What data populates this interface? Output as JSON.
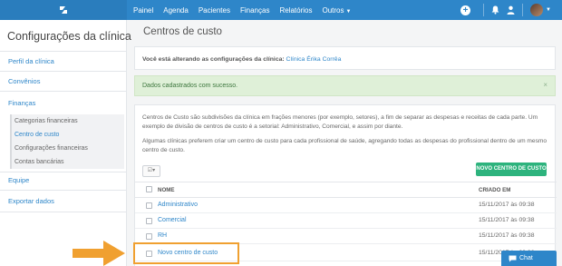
{
  "topbar": {
    "nav": [
      {
        "label": "Painel",
        "has_caret": false
      },
      {
        "label": "Agenda",
        "has_caret": false
      },
      {
        "label": "Pacientes",
        "has_caret": false
      },
      {
        "label": "Finanças",
        "has_caret": false
      },
      {
        "label": "Relatórios",
        "has_caret": false
      },
      {
        "label": "Outros",
        "has_caret": true
      }
    ],
    "icons": [
      "logo-icon",
      "add-circle-icon",
      "bell-icon",
      "user-icon",
      "avatar",
      "chevron-down-icon"
    ]
  },
  "sidebar": {
    "title": "Configurações da clínica",
    "links": {
      "perfil": "Perfil da clínica",
      "convenios": "Convênios",
      "financas": "Finanças",
      "equipe": "Equipe",
      "exportar": "Exportar dados"
    },
    "sub_items": [
      {
        "label": "Categorias financeiras",
        "active": false
      },
      {
        "label": "Centro de custo",
        "active": true
      },
      {
        "label": "Configurações financeiras",
        "active": false
      },
      {
        "label": "Contas bancárias",
        "active": false
      }
    ]
  },
  "main": {
    "title": "Centros de custo",
    "clinic_notice_prefix": "Você está alterando as configurações da clínica:",
    "clinic_name": "Clínica Érika Corrêa",
    "alert": {
      "message": "Dados cadastrados com sucesso.",
      "close": "×"
    },
    "description_1": "Centros de Custo são subdivisões da clínica em frações menores (por exemplo, setores), a fim de separar as despesas e receitas de cada parte. Um exemplo de divisão de centros de custo é a setorial: Administrativo, Comercial, e assim por diante.",
    "description_2": "Algumas clínicas preferem criar um centro de custo para cada profissional de saúde, agregando todas as despesas do profissional dentro de um mesmo centro de custo.",
    "filter_button": "☑▾",
    "new_button": "NOVO CENTRO DE CUSTO",
    "table": {
      "headers": {
        "name": "NOME",
        "created": "CRIADO EM"
      },
      "rows": [
        {
          "name": "Administrativo",
          "created": "15/11/2017 às 09:38"
        },
        {
          "name": "Comercial",
          "created": "15/11/2017 às 09:38"
        },
        {
          "name": "RH",
          "created": "15/11/2017 às 09:38"
        },
        {
          "name": "Novo centro de custo",
          "created": "15/11/2017 às 09:38"
        }
      ]
    }
  },
  "chat": {
    "label": "Chat"
  },
  "colors": {
    "brand_blue": "#2e86c9",
    "success_green": "#2db37d",
    "alert_bg": "#dff0d8",
    "highlight_orange": "#f0a030"
  }
}
